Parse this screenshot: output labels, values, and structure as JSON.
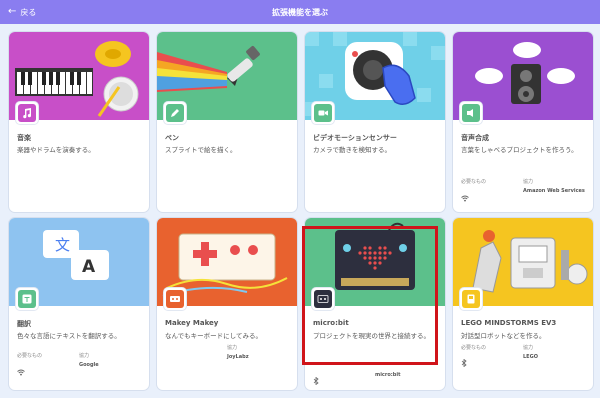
{
  "header": {
    "back_label": "戻る",
    "title": "拡張機能を選ぶ"
  },
  "meta": {
    "requirements_label": "必要なもの",
    "collab_label": "協力"
  },
  "cards": [
    {
      "name": "音楽",
      "description": "楽器やドラムを演奏する。"
    },
    {
      "name": "ペン",
      "description": "スプライトで絵を描く。"
    },
    {
      "name": "ビデオモーションセンサー",
      "description": "カメラで動きを検知する。"
    },
    {
      "name": "音声合成",
      "description": "言葉をしゃべるプロジェクトを作ろう。",
      "collaborator": "Amazon Web Services"
    },
    {
      "name": "翻訳",
      "description": "色々な言語にテキストを翻訳する。",
      "collaborator": "Google"
    },
    {
      "name": "Makey Makey",
      "description": "なんでもキーボードにしてみる。",
      "collaborator": "JoyLabz"
    },
    {
      "name": "micro:bit",
      "description": "プロジェクトを現実の世界と接続する。",
      "collaborator": "micro:bit"
    },
    {
      "name": "LEGO MINDSTORMS EV3",
      "description": "対話型ロボットなどを作る。",
      "collaborator": "LEGO"
    }
  ],
  "colors": {
    "header": "#8a7df0",
    "background": "#e9f0fb",
    "highlight": "#d0141a",
    "music_bg": "#c84fc8",
    "pen_bg": "#5cc08b",
    "video_bg": "#6fd0e8",
    "tts_bg": "#9b4fd1",
    "translate_bg": "#8ec3f0",
    "makey_bg": "#e8622f",
    "microbit_bg": "#5cc08b",
    "lego_bg": "#f5c520"
  }
}
